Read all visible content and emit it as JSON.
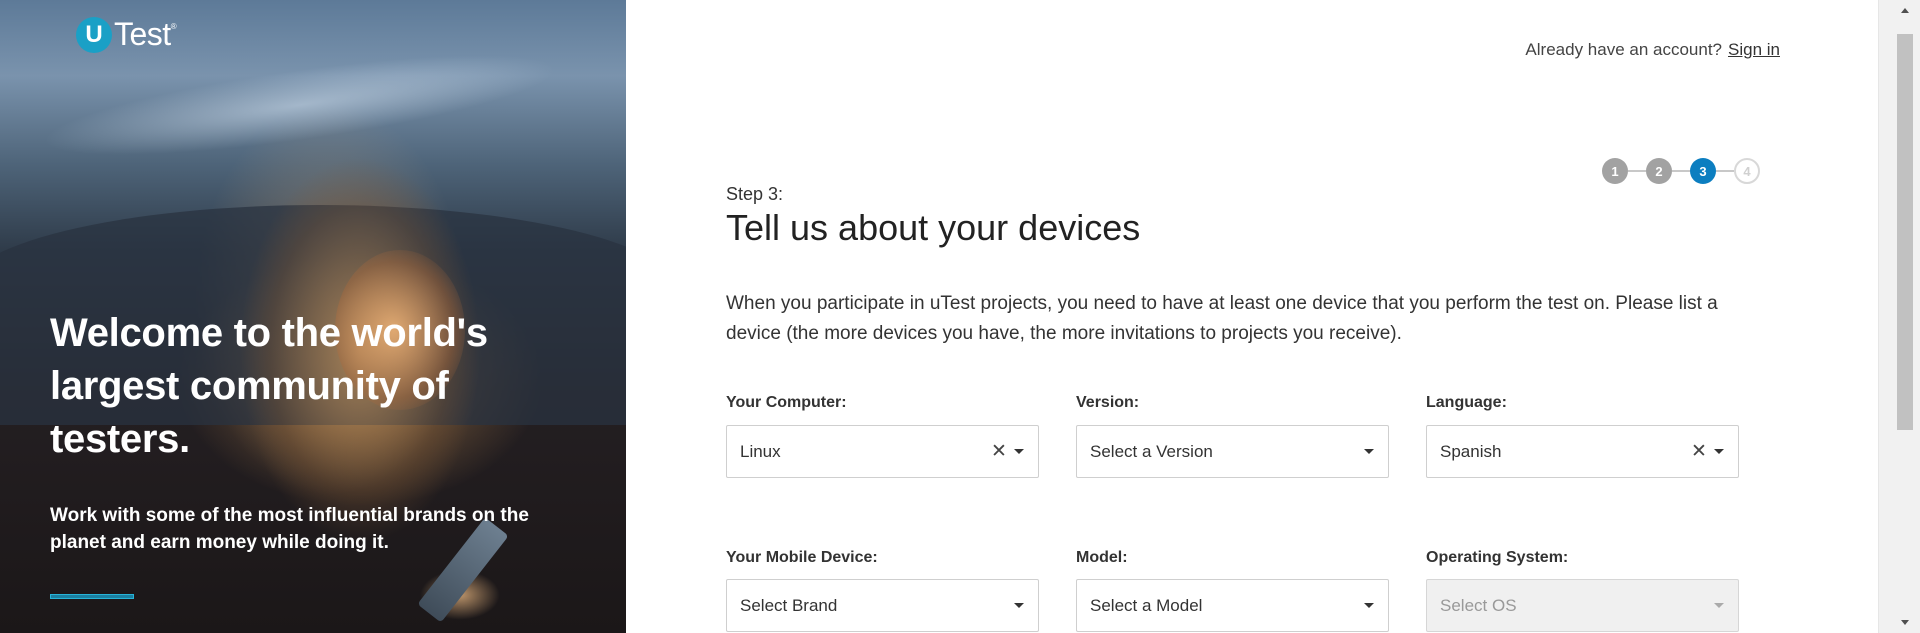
{
  "hero": {
    "logo_letter": "U",
    "logo_word": "Test",
    "logo_tm": "®",
    "title": "Welcome to the world's largest community of testers.",
    "subtitle": "Work with some of the most influential brands on the planet and earn money while doing it."
  },
  "header": {
    "account_prompt": "Already have an account?",
    "signin_label": "Sign in"
  },
  "stepper": {
    "steps": [
      "1",
      "2",
      "3",
      "4"
    ],
    "current": 3
  },
  "form": {
    "step_label": "Step 3:",
    "title": "Tell us about your devices",
    "intro": "When you participate in uTest projects, you need to have at least one device that you perform the test on. Please list a device (the more devices you have, the more invitations to projects you receive).",
    "computer": {
      "label": "Your Computer:",
      "value": "Linux"
    },
    "version": {
      "label": "Version:",
      "value": "Select a Version"
    },
    "language": {
      "label": "Language:",
      "value": "Spanish"
    },
    "mobile": {
      "label": "Your Mobile Device:",
      "value": "Select Brand"
    },
    "model": {
      "label": "Model:",
      "value": "Select a Model"
    },
    "os": {
      "label": "Operating System:",
      "value": "Select OS"
    },
    "clear_glyph": "✕"
  },
  "colors": {
    "brand": "#1aa0c6",
    "step_current": "#0c7ec0",
    "step_done": "#a2a2a2"
  }
}
